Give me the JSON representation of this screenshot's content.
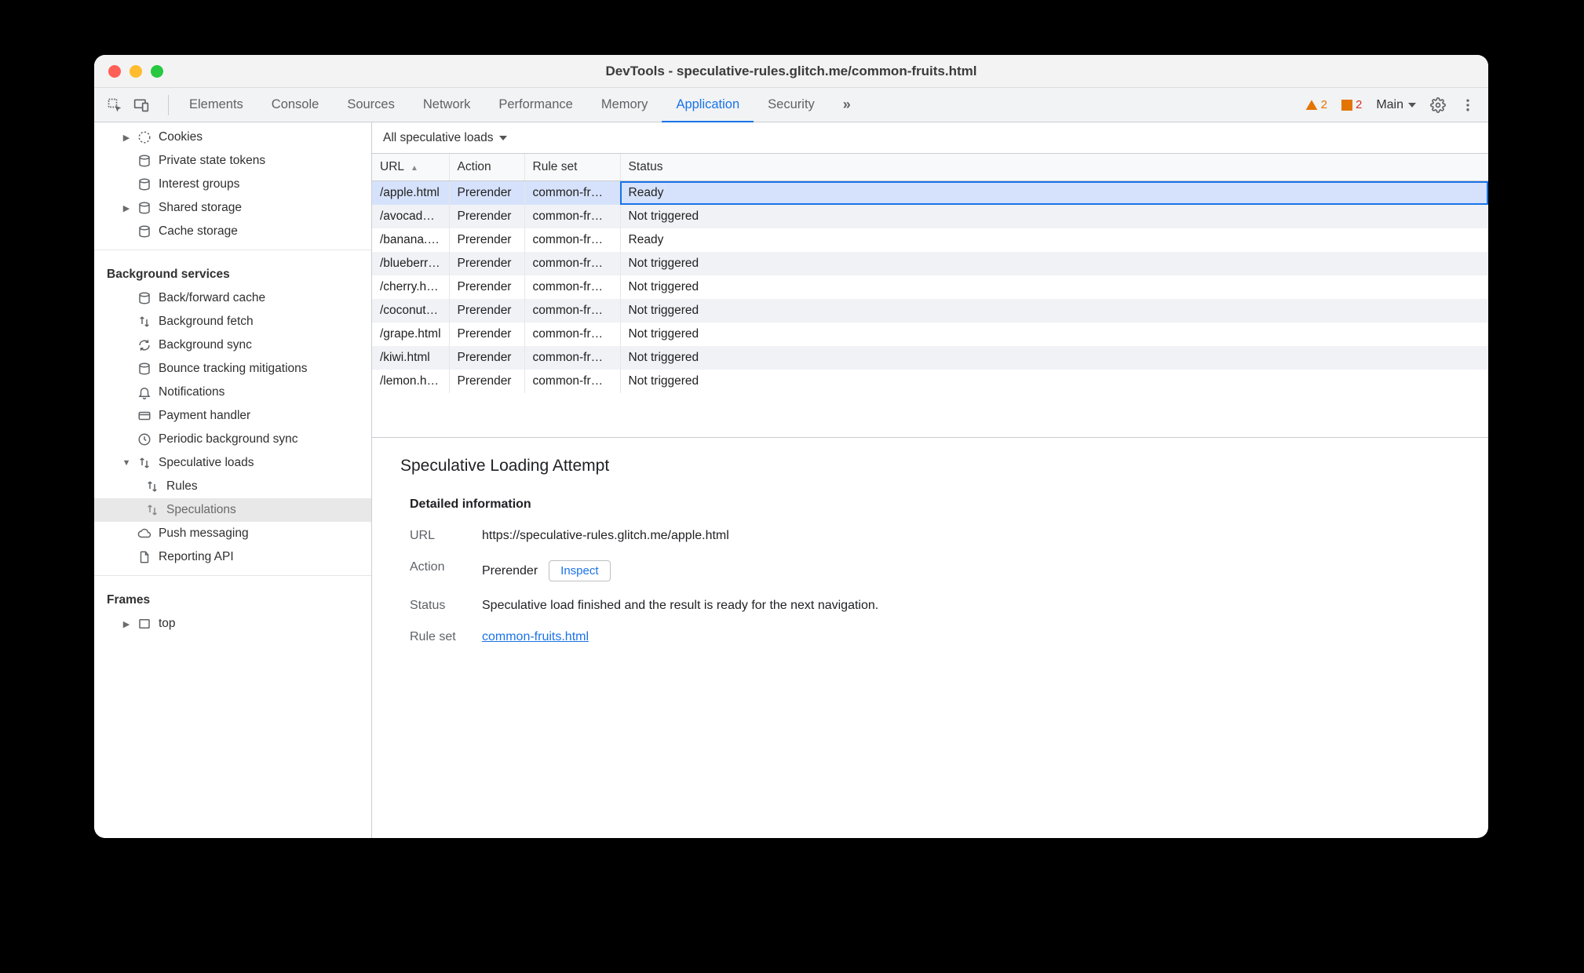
{
  "window_title": "DevTools - speculative-rules.glitch.me/common-fruits.html",
  "toolbar": {
    "tabs": [
      "Elements",
      "Console",
      "Sources",
      "Network",
      "Performance",
      "Memory",
      "Application",
      "Security"
    ],
    "active_tab": "Application",
    "warn_count": "2",
    "err_count": "2",
    "frame_dropdown": "Main"
  },
  "sidebar": {
    "storage": {
      "cookies": "Cookies",
      "private_tokens": "Private state tokens",
      "interest_groups": "Interest groups",
      "shared_storage": "Shared storage",
      "cache_storage": "Cache storage"
    },
    "bg_heading": "Background services",
    "bg": {
      "bfcache": "Back/forward cache",
      "bg_fetch": "Background fetch",
      "bg_sync": "Background sync",
      "bounce": "Bounce tracking mitigations",
      "notifications": "Notifications",
      "payment": "Payment handler",
      "periodic": "Periodic background sync",
      "spec_loads": "Speculative loads",
      "rules": "Rules",
      "speculations": "Speculations",
      "push": "Push messaging",
      "reporting": "Reporting API"
    },
    "frames_heading": "Frames",
    "frames_top": "top"
  },
  "panel": {
    "filter": "All speculative loads",
    "columns": {
      "url": "URL",
      "action": "Action",
      "ruleset": "Rule set",
      "status": "Status"
    },
    "rows": [
      {
        "url": "/apple.html",
        "action": "Prerender",
        "ruleset": "common-fr…",
        "status": "Ready",
        "selected": true
      },
      {
        "url": "/avocad…",
        "action": "Prerender",
        "ruleset": "common-fr…",
        "status": "Not triggered"
      },
      {
        "url": "/banana.…",
        "action": "Prerender",
        "ruleset": "common-fr…",
        "status": "Ready"
      },
      {
        "url": "/blueberr…",
        "action": "Prerender",
        "ruleset": "common-fr…",
        "status": "Not triggered"
      },
      {
        "url": "/cherry.h…",
        "action": "Prerender",
        "ruleset": "common-fr…",
        "status": "Not triggered"
      },
      {
        "url": "/coconut…",
        "action": "Prerender",
        "ruleset": "common-fr…",
        "status": "Not triggered"
      },
      {
        "url": "/grape.html",
        "action": "Prerender",
        "ruleset": "common-fr…",
        "status": "Not triggered"
      },
      {
        "url": "/kiwi.html",
        "action": "Prerender",
        "ruleset": "common-fr…",
        "status": "Not triggered"
      },
      {
        "url": "/lemon.h…",
        "action": "Prerender",
        "ruleset": "common-fr…",
        "status": "Not triggered"
      }
    ]
  },
  "details": {
    "heading": "Speculative Loading Attempt",
    "subheading": "Detailed information",
    "labels": {
      "url": "URL",
      "action": "Action",
      "status": "Status",
      "ruleset": "Rule set"
    },
    "url": "https://speculative-rules.glitch.me/apple.html",
    "action": "Prerender",
    "inspect": "Inspect",
    "status": "Speculative load finished and the result is ready for the next navigation.",
    "ruleset": "common-fruits.html"
  }
}
